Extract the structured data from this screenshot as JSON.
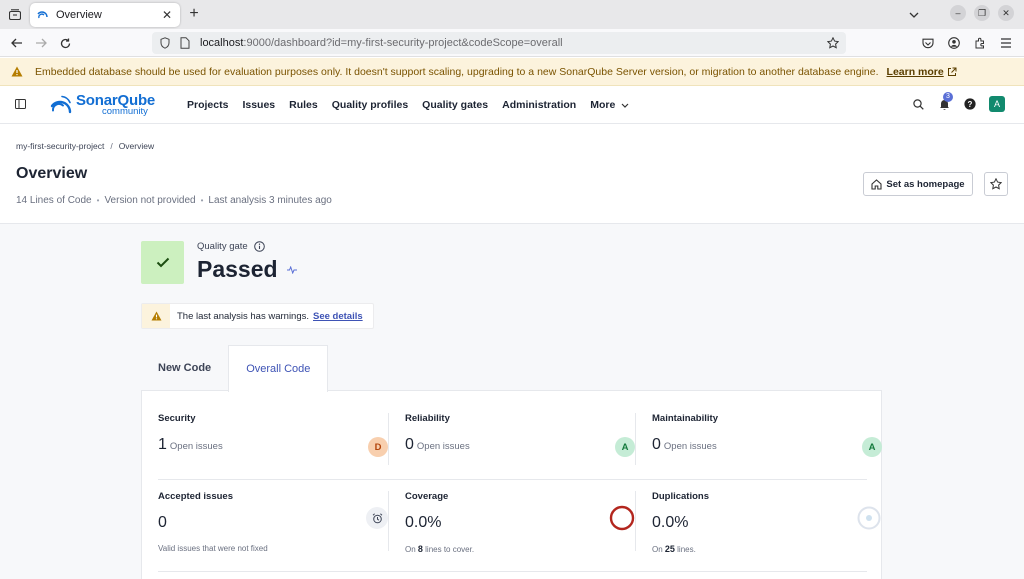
{
  "browser": {
    "tab_title": "Overview",
    "url_host": "localhost",
    "url_rest": ":9000/dashboard?id=my-first-security-project&codeScope=overall"
  },
  "banner": {
    "text": "Embedded database should be used for evaluation purposes only. It doesn't support scaling, upgrading to a new SonarQube Server version, or migration to another database engine.",
    "link": "Learn more"
  },
  "header": {
    "logo_name": "SonarQube",
    "logo_edition": "community",
    "menu": [
      "Projects",
      "Issues",
      "Rules",
      "Quality profiles",
      "Quality gates",
      "Administration"
    ],
    "more": "More",
    "notification_count": "3",
    "avatar_letter": "A"
  },
  "project": {
    "breadcrumb_project": "my-first-security-project",
    "breadcrumb_separator": "/",
    "breadcrumb_page": "Overview",
    "title": "Overview",
    "lines_of_code": "14 Lines of Code",
    "version": "Version not provided",
    "last_analysis": "Last analysis 3 minutes ago",
    "set_homepage": "Set as homepage"
  },
  "quality_gate": {
    "label": "Quality gate",
    "status": "Passed"
  },
  "warning": {
    "text": "The last analysis has warnings.",
    "link": "See details"
  },
  "tabs": [
    "New Code",
    "Overall Code"
  ],
  "metrics": {
    "security": {
      "title": "Security",
      "value": "1",
      "unit": "Open issues",
      "rating": "D"
    },
    "reliability": {
      "title": "Reliability",
      "value": "0",
      "unit": "Open issues",
      "rating": "A"
    },
    "maintainability": {
      "title": "Maintainability",
      "value": "0",
      "unit": "Open issues",
      "rating": "A"
    },
    "accepted": {
      "title": "Accepted issues",
      "value": "0",
      "note": "Valid issues that were not fixed"
    },
    "coverage": {
      "title": "Coverage",
      "value": "0.0%",
      "note_prefix": "On",
      "note_num": "8",
      "note_suffix": "lines to cover."
    },
    "duplications": {
      "title": "Duplications",
      "value": "0.0%",
      "note_prefix": "On",
      "note_num": "25",
      "note_suffix": "lines."
    }
  },
  "colors": {
    "accent": "#3e53b5",
    "rating_d": "#f8cfae",
    "rating_a": "#c5ecd6",
    "coverage_ring": "#b3261e"
  }
}
